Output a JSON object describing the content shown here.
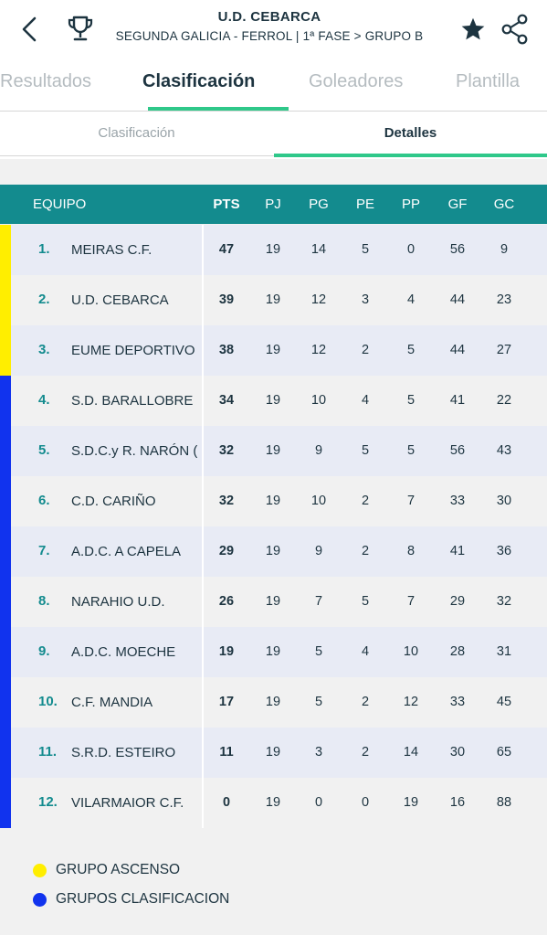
{
  "header": {
    "team_title": "U.D. CEBARCA",
    "competition": "SEGUNDA GALICIA - FERROL | 1ª FASE > GRUPO B",
    "icons": [
      "back-arrow-icon",
      "trophy-icon",
      "star-icon",
      "share-icon"
    ]
  },
  "main_tabs": [
    {
      "label": "Resultados",
      "active": false
    },
    {
      "label": "Clasificación",
      "active": true
    },
    {
      "label": "Goleadores",
      "active": false
    },
    {
      "label": "Plantilla",
      "active": false
    }
  ],
  "sub_tabs": [
    {
      "label": "Clasificación",
      "active": false
    },
    {
      "label": "Detalles",
      "active": true
    }
  ],
  "table": {
    "headers": {
      "team": "EQUIPO",
      "pts": "PTS",
      "pj": "PJ",
      "pg": "PG",
      "pe": "PE",
      "pp": "PP",
      "gf": "GF",
      "gc": "GC"
    },
    "rows": [
      {
        "pos": "1.",
        "team": "MEIRAS C.F.",
        "pts": "47",
        "pj": "19",
        "pg": "14",
        "pe": "5",
        "pp": "0",
        "gf": "56",
        "gc": "9",
        "zone": "ascenso"
      },
      {
        "pos": "2.",
        "team": "U.D. CEBARCA",
        "pts": "39",
        "pj": "19",
        "pg": "12",
        "pe": "3",
        "pp": "4",
        "gf": "44",
        "gc": "23",
        "zone": "ascenso"
      },
      {
        "pos": "3.",
        "team": "EUME DEPORTIVO '",
        "pts": "38",
        "pj": "19",
        "pg": "12",
        "pe": "2",
        "pp": "5",
        "gf": "44",
        "gc": "27",
        "zone": "ascenso"
      },
      {
        "pos": "4.",
        "team": "S.D. BARALLOBRE",
        "pts": "34",
        "pj": "19",
        "pg": "10",
        "pe": "4",
        "pp": "5",
        "gf": "41",
        "gc": "22",
        "zone": "clasificacion"
      },
      {
        "pos": "5.",
        "team": "S.D.C.y R. NARÓN (",
        "pts": "32",
        "pj": "19",
        "pg": "9",
        "pe": "5",
        "pp": "5",
        "gf": "56",
        "gc": "43",
        "zone": "clasificacion"
      },
      {
        "pos": "6.",
        "team": "C.D. CARIÑO",
        "pts": "32",
        "pj": "19",
        "pg": "10",
        "pe": "2",
        "pp": "7",
        "gf": "33",
        "gc": "30",
        "zone": "clasificacion"
      },
      {
        "pos": "7.",
        "team": "A.D.C. A CAPELA",
        "pts": "29",
        "pj": "19",
        "pg": "9",
        "pe": "2",
        "pp": "8",
        "gf": "41",
        "gc": "36",
        "zone": "clasificacion"
      },
      {
        "pos": "8.",
        "team": "NARAHIO U.D.",
        "pts": "26",
        "pj": "19",
        "pg": "7",
        "pe": "5",
        "pp": "7",
        "gf": "29",
        "gc": "32",
        "zone": "clasificacion"
      },
      {
        "pos": "9.",
        "team": "A.D.C. MOECHE",
        "pts": "19",
        "pj": "19",
        "pg": "5",
        "pe": "4",
        "pp": "10",
        "gf": "28",
        "gc": "31",
        "zone": "clasificacion"
      },
      {
        "pos": "10.",
        "team": "C.F. MANDIA",
        "pts": "17",
        "pj": "19",
        "pg": "5",
        "pe": "2",
        "pp": "12",
        "gf": "33",
        "gc": "45",
        "zone": "clasificacion"
      },
      {
        "pos": "11.",
        "team": "S.R.D. ESTEIRO",
        "pts": "11",
        "pj": "19",
        "pg": "3",
        "pe": "2",
        "pp": "14",
        "gf": "30",
        "gc": "65",
        "zone": "clasificacion"
      },
      {
        "pos": "12.",
        "team": "VILARMAIOR C.F.",
        "pts": "0",
        "pj": "19",
        "pg": "0",
        "pe": "0",
        "pp": "19",
        "gf": "16",
        "gc": "88",
        "zone": "clasificacion"
      }
    ]
  },
  "zones": {
    "ascenso": {
      "color": "#ffee00"
    },
    "clasificacion": {
      "color": "#1133ee"
    }
  },
  "legend": [
    {
      "label": "GRUPO ASCENSO",
      "color": "#ffee00"
    },
    {
      "label": "GRUPOS CLASIFICACION",
      "color": "#1133ee"
    }
  ],
  "colors": {
    "accent": "#2fc88a",
    "header_bg": "#138b8e",
    "text": "#1d3440"
  }
}
